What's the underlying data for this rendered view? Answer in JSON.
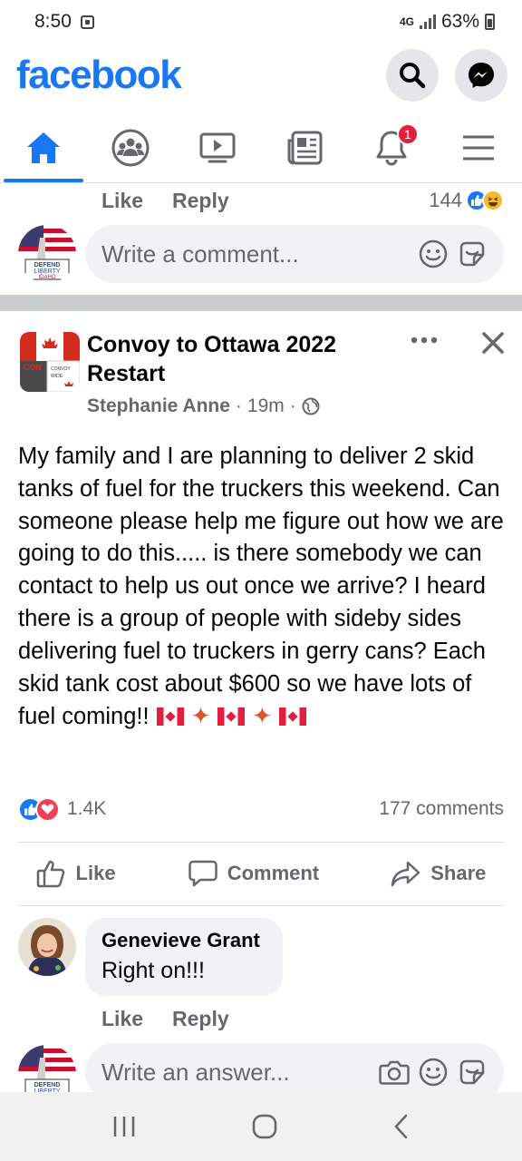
{
  "status": {
    "time": "8:50",
    "network": "4G",
    "battery": "63%"
  },
  "header": {
    "logo": "facebook"
  },
  "nav": {
    "notifications_badge": "1"
  },
  "previous_comment": {
    "like_label": "Like",
    "reply_label": "Reply",
    "reaction_count": "144"
  },
  "composer_top": {
    "placeholder": "Write a comment..."
  },
  "post": {
    "group_name": "Convoy to Ottawa 2022 Restart",
    "author": "Stephanie Anne",
    "time": "19m",
    "separator": "·",
    "text": "My family and I are planning to deliver 2 skid tanks of fuel for the truckers this weekend. Can someone please help me figure out how we are going to do this..... is there somebody we can contact to help us out once we arrive? I heard there is a group of people with sideby sides delivering fuel to truckers in gerry cans? Each skid tank cost about $600 so we have lots of fuel coming!!",
    "reaction_count": "1.4K",
    "comment_count": "177 comments",
    "actions": {
      "like": "Like",
      "comment": "Comment",
      "share": "Share"
    }
  },
  "comment": {
    "author": "Genevieve Grant",
    "text": "Right on!!!",
    "like_label": "Like",
    "reply_label": "Reply"
  },
  "composer_bottom": {
    "placeholder": "Write an answer..."
  },
  "colors": {
    "brand": "#1877f2",
    "love": "#f33e58",
    "badge": "#e41e3f"
  }
}
